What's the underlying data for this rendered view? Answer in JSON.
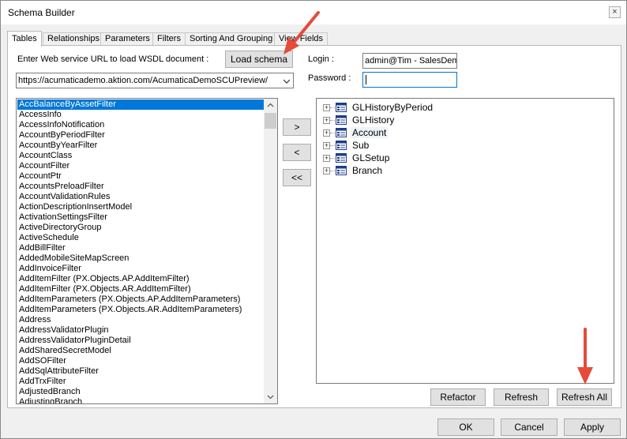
{
  "window": {
    "title": "Schema Builder",
    "close_glyph": "×"
  },
  "tabs": [
    {
      "label": "Tables"
    },
    {
      "label": "Relationships"
    },
    {
      "label": "Parameters"
    },
    {
      "label": "Filters"
    },
    {
      "label": "Sorting And Grouping"
    },
    {
      "label": "View Fields"
    }
  ],
  "wsdl": {
    "label": "Enter Web service URL to load WSDL document :",
    "url": "https://acumaticademo.aktion.com/AcumaticaDemoSCUPreview/",
    "load_label": "Load schema"
  },
  "login": {
    "label": "Login :",
    "value": "admin@Tim - SalesDemo"
  },
  "password": {
    "label": "Password :",
    "value": ""
  },
  "move": {
    "add": ">",
    "remove": "<",
    "remove_all": "<<"
  },
  "list_items": [
    "AccBalanceByAssetFilter",
    "AccessInfo",
    "AccessInfoNotification",
    "AccountByPeriodFilter",
    "AccountByYearFilter",
    "AccountClass",
    "AccountFilter",
    "AccountPtr",
    "AccountsPreloadFilter",
    "AccountValidationRules",
    "ActionDescriptionInsertModel",
    "ActivationSettingsFilter",
    "ActiveDirectoryGroup",
    "ActiveSchedule",
    "AddBillFilter",
    "AddedMobileSiteMapScreen",
    "AddInvoiceFilter",
    "AddItemFilter (PX.Objects.AP.AddItemFilter)",
    "AddItemFilter (PX.Objects.AR.AddItemFilter)",
    "AddItemParameters (PX.Objects.AP.AddItemParameters)",
    "AddItemParameters (PX.Objects.AR.AddItemParameters)",
    "Address",
    "AddressValidatorPlugin",
    "AddressValidatorPluginDetail",
    "AddSharedSecretModel",
    "AddSOFilter",
    "AddSqlAttributeFilter",
    "AddTrxFilter",
    "AdjustedBranch",
    "AdjustingBranch"
  ],
  "tree_nodes": [
    {
      "label": "GLHistoryByPeriod"
    },
    {
      "label": "GLHistory"
    },
    {
      "label": "Account"
    },
    {
      "label": "Sub"
    },
    {
      "label": "GLSetup"
    },
    {
      "label": "Branch"
    }
  ],
  "tree_expander_glyph": "+",
  "actions": {
    "refactor": "Refactor",
    "refresh": "Refresh",
    "refresh_all": "Refresh All"
  },
  "footer": {
    "ok": "OK",
    "cancel": "Cancel",
    "apply": "Apply"
  },
  "colors": {
    "selection": "#0078d7",
    "annotation_arrow": "#e64a3b",
    "focus_border": "#0078d7"
  }
}
